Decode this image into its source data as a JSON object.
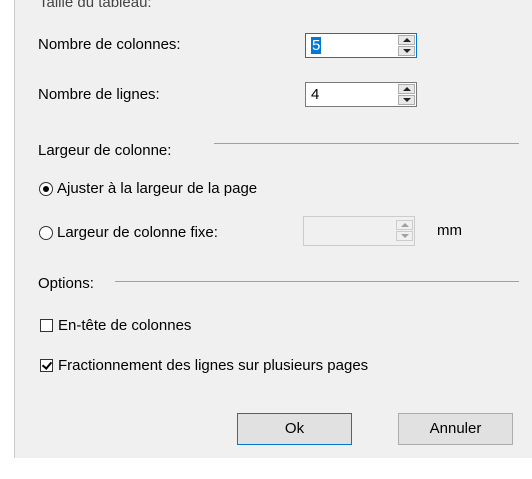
{
  "section_size": {
    "label": "Taille du tableau:"
  },
  "columns": {
    "label": "Nombre de colonnes:",
    "value": "5"
  },
  "rows": {
    "label": "Nombre de lignes:",
    "value": "4"
  },
  "column_width": {
    "label": "Largeur de colonne:",
    "fit_page_label": "Ajuster à la largeur de la page",
    "fixed_label": "Largeur de colonne fixe:",
    "fixed_value": "",
    "unit": "mm",
    "selected": "fit_page"
  },
  "options": {
    "label": "Options:",
    "header_label": "En-tête de colonnes",
    "header_checked": false,
    "split_label": "Fractionnement des lignes sur plusieurs pages",
    "split_checked": true
  },
  "buttons": {
    "ok": "Ok",
    "cancel": "Annuler"
  },
  "colors": {
    "dialog_bg": "#f0f0f0",
    "focus_border": "#0078d7",
    "selection": "#0078d7"
  }
}
